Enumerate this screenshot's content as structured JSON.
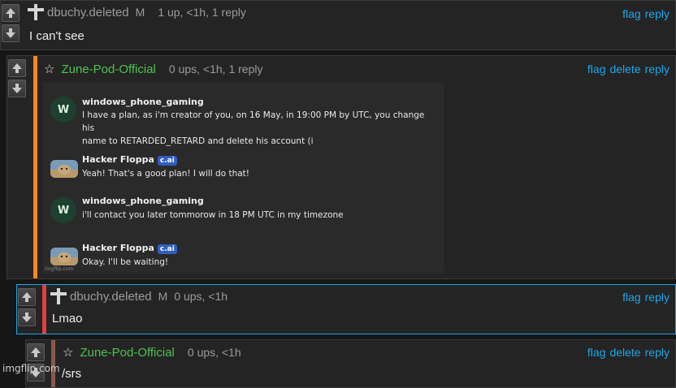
{
  "comments": [
    {
      "username": "dbuchy.deleted",
      "mod_badge": "M",
      "meta": "1 up, <1h, 1 reply",
      "actions": [
        "flag",
        "reply"
      ],
      "text": "I can't see"
    },
    {
      "username": "Zune-Pod-Official",
      "meta": "0 ups, <1h, 1 reply",
      "actions": [
        "flag",
        "delete",
        "reply"
      ],
      "text": ""
    },
    {
      "username": "dbuchy.deleted",
      "mod_badge": "M",
      "meta": "0 ups, <1h",
      "actions": [
        "flag",
        "reply"
      ],
      "text": "Lmao"
    },
    {
      "username": "Zune-Pod-Official",
      "meta": "0 ups, <1h",
      "actions": [
        "flag",
        "delete",
        "reply"
      ],
      "text": "/srs"
    }
  ],
  "embedded_chat": {
    "messages": [
      {
        "sender": "windows_phone_gaming",
        "avatar_letter": "W",
        "lines": [
          "I have a plan, as i'm creator of you, on 16 May, in 19:00 PM by UTC, you change his",
          "name to RETARDED_RETARD and delete his account (i"
        ]
      },
      {
        "sender": "Hacker Floppa",
        "badge": "c.ai",
        "lines": [
          "Yeah! That's a good plan! I will do that!"
        ]
      },
      {
        "sender": "windows_phone_gaming",
        "avatar_letter": "W",
        "lines": [
          "i'll contact you later tommorow in 18 PM UTC in my timezone"
        ]
      },
      {
        "sender": "Hacker Floppa",
        "badge": "c.ai",
        "lines": [
          "Okay. I'll be waiting!"
        ]
      }
    ],
    "watermark": "imgflip.com"
  },
  "watermark": "imgflip.com",
  "colors": {
    "link": "#1ea7e8",
    "username_green": "#4ec24e",
    "bar_orange": "#f58a1f",
    "bar_red": "#e04040",
    "bar_brown": "#8a5a4a"
  },
  "icons": {
    "upvote": "arrow-up-icon",
    "downvote": "arrow-down-icon",
    "deleted_user": "cross-icon",
    "star": "star-icon"
  }
}
